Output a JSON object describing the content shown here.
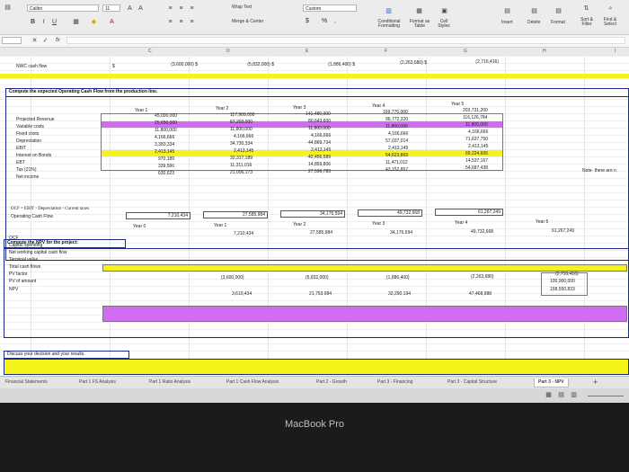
{
  "ribbon": {
    "font_name": "Calibri",
    "font_size": "11",
    "wrap_text": "Wrap Text",
    "merge_center": "Merge & Center",
    "number_format": "Custom",
    "currency": "$",
    "percent": "%",
    "comma": ",",
    "conditional_formatting": "Conditional Formatting",
    "format_as_table": "Format as Table",
    "cell_styles": "Cell Styles",
    "insert": "Insert",
    "delete": "Delete",
    "format": "Format",
    "sort_filter": "Sort & Filter",
    "find_select": "Find & Select"
  },
  "formula_bar": {
    "fx": "fx"
  },
  "columns": [
    "C",
    "D",
    "E",
    "F",
    "G",
    "H",
    "I"
  ],
  "nwc_row": {
    "label": "NWC cash flow",
    "values": [
      "(3,600,000) $",
      "(5,832,000) $",
      "(1,886,400) $",
      "(2,263,680) $",
      "(2,716,416)"
    ],
    "dollar": "$"
  },
  "ocf_section": {
    "title": "Compute the expected Operating Cash Flow from the production line.",
    "years": [
      "Year 1",
      "Year 2",
      "Year 3",
      "Year 4",
      "Year 5"
    ],
    "row_labels": [
      "Projected Revenue",
      "Variable costs",
      "Fixed costs",
      "Depreciation",
      "EBIT",
      "Interest on Bonds",
      "EBT",
      "Tax (21%)",
      "Net income"
    ],
    "rows": [
      [
        "45,000,000",
        "117,900,000",
        "141,480,000",
        "169,776,000",
        "203,731,200"
      ],
      [
        "25,650,000",
        "67,203,000",
        "80,643,600",
        "96,772,320",
        "116,126,784"
      ],
      [
        "11,800,000",
        "11,800,000",
        "11,800,000",
        "11,800,000",
        "11,800,000"
      ],
      [
        "4,166,666",
        "4,166,666",
        "4,166,666",
        "4,166,666",
        "4,166,666"
      ],
      [
        "3,383,334",
        "34,730,334",
        "44,869,734",
        "57,037,014",
        "71,637,750"
      ],
      [
        "2,413,145",
        "2,413,145",
        "2,413,145",
        "2,413,145",
        "2,413,145"
      ],
      [
        "970,189",
        "32,317,189",
        "42,456,589",
        "54,623,869",
        "69,224,605"
      ],
      [
        "339,566",
        "11,311,016",
        "14,859,806",
        "11,471,012",
        "14,537,167"
      ],
      [
        "630,623",
        "21,006,173",
        "27,596,783",
        "43,152,857",
        "54,687,438"
      ]
    ],
    "note": "Note- there are n",
    "formula_label": "OCF = EBIT - Depreciation - Current taxes",
    "ocf_label": "Operating Cash Flow",
    "ocf_values": [
      "7,210,434",
      "27,585,984",
      "34,176,594",
      "49,732,668",
      "61,267,249"
    ]
  },
  "npv_section": {
    "title": "Compute the NPV for the project:",
    "years": [
      "Year 0",
      "Year 1",
      "Year 2",
      "Year 3",
      "Year 4",
      "Year 5"
    ],
    "row_labels": [
      "OCF",
      "Capital spending",
      "Net working capital cash flow",
      "Terminal value",
      "Total cash flows",
      "PV factor",
      "PV of amount",
      "NPV"
    ],
    "ocf": [
      "7,210,434",
      "27,585,984",
      "34,176,594",
      "49,732,668",
      "61,267,249"
    ],
    "nwc": [
      "(3,600,000)",
      "(5,832,000)",
      "(1,886,400)",
      "(2,263,680)",
      "(2,716,416)"
    ],
    "terminal": "100,000,000",
    "total": [
      "3,610,434",
      "21,753,984",
      "32,290,194",
      "47,468,988",
      "158,550,833"
    ]
  },
  "decision": {
    "title": "Discuss your decision and your results."
  },
  "tabs": [
    "Financial Statements",
    "Part 1 FS Analysis",
    "Part 1 Ratio Analysis",
    "Part 1 Cash Flow Analysis",
    "Part 2 - Growth",
    "Part 3 - Financing",
    "Part 3 - Capital Structure",
    "Part 3 - NPV",
    "+"
  ],
  "bezel": {
    "label": "MacBook Pro"
  },
  "colors": {
    "yellow": "#f4f41a",
    "purple": "#cf6cf2",
    "section_border": "#1a2a8a"
  }
}
